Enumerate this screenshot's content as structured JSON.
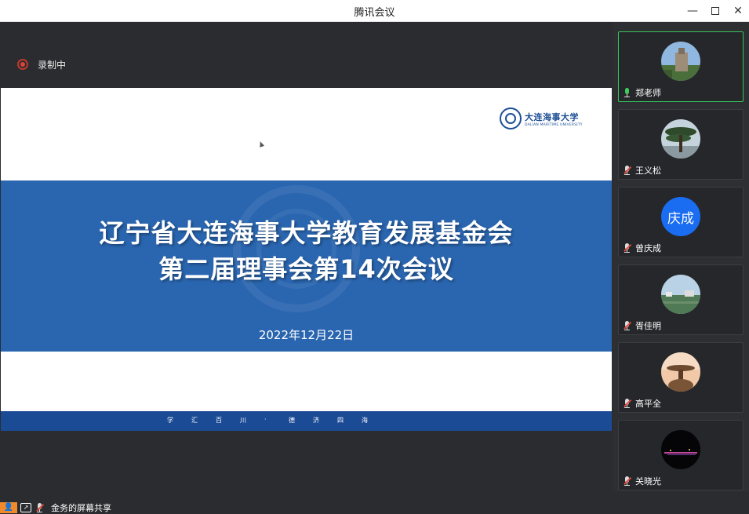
{
  "window": {
    "title": "腾讯会议"
  },
  "recording": {
    "label": "录制中"
  },
  "slide": {
    "logo_cn": "大连海事大学",
    "logo_en": "DALIAN MARITIME UNIVERSITY",
    "title_line1": "辽宁省大连海事大学教育发展基金会",
    "title_line2": "第二届理事会第14次会议",
    "date": "2022年12月22日",
    "motto": [
      "学",
      "汇",
      "百",
      "川",
      "·",
      "德",
      "济",
      "四",
      "海"
    ]
  },
  "share": {
    "text": "金务的屏幕共享"
  },
  "participants": [
    {
      "name": "郑老师",
      "mic": "on",
      "avatar": "photo-castle"
    },
    {
      "name": "王义松",
      "mic": "off",
      "avatar": "photo-pine"
    },
    {
      "name": "曾庆成",
      "mic": "off",
      "avatar_text": "庆成",
      "avatar_color": "#1a6cf0"
    },
    {
      "name": "胥佳明",
      "mic": "off",
      "avatar": "photo-landscape"
    },
    {
      "name": "高平全",
      "mic": "off",
      "avatar": "photo-rock"
    },
    {
      "name": "关晓光",
      "mic": "off",
      "avatar": "photo-night"
    }
  ],
  "colors": {
    "accent_green": "#37c55a",
    "slide_blue": "#2a66b0",
    "slide_dark_blue": "#1c4b96",
    "record_red": "#d9453b"
  }
}
